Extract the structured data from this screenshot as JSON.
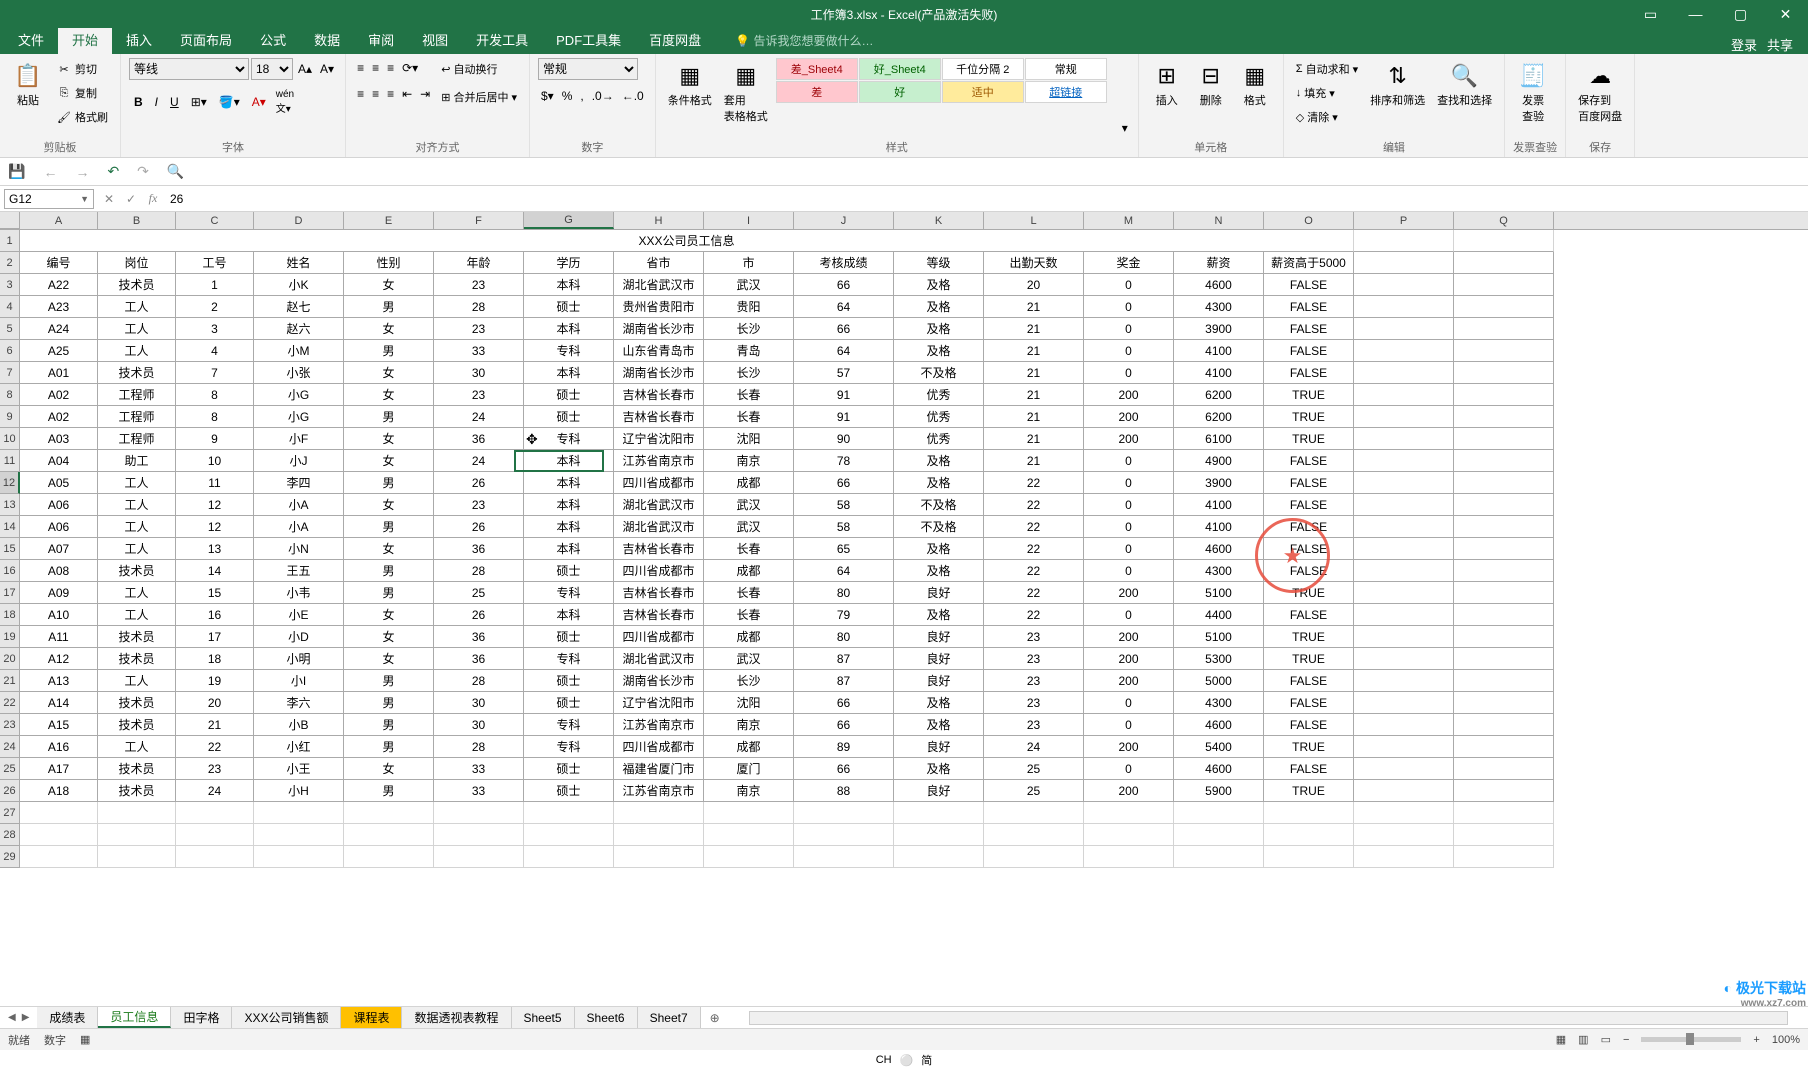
{
  "titlebar": {
    "title": "工作簿3.xlsx - Excel(产品激活失败)"
  },
  "ribbon_tabs": {
    "file": "文件",
    "home": "开始",
    "insert": "插入",
    "page_layout": "页面布局",
    "formulas": "公式",
    "data": "数据",
    "review": "审阅",
    "view": "视图",
    "dev": "开发工具",
    "pdf": "PDF工具集",
    "baidu": "百度网盘",
    "search_hint": "告诉我您想要做什么…",
    "login": "登录",
    "share": "共享"
  },
  "ribbon": {
    "clipboard": {
      "paste": "粘贴",
      "cut": "剪切",
      "copy": "复制",
      "format_painter": "格式刷",
      "group": "剪贴板"
    },
    "font": {
      "name": "等线",
      "size": "18",
      "group": "字体"
    },
    "align": {
      "wrap": "自动换行",
      "merge": "合并后居中",
      "group": "对齐方式"
    },
    "number": {
      "format": "常规",
      "group": "数字"
    },
    "styles": {
      "cond_format": "条件格式",
      "table_format": "套用\n表格格式",
      "s1": "差_Sheet4",
      "s2": "好_Sheet4",
      "s3": "千位分隔 2",
      "s4": "常规",
      "s5": "差",
      "s6": "好",
      "s7": "适中",
      "s8": "超链接",
      "group": "样式"
    },
    "cells": {
      "insert": "插入",
      "delete": "删除",
      "format": "格式",
      "group": "单元格"
    },
    "editing": {
      "autosum": "自动求和",
      "fill": "填充",
      "clear": "清除",
      "sort": "排序和筛选",
      "find": "查找和选择",
      "group": "编辑"
    },
    "invoice": {
      "check": "发票\n查验",
      "group": "发票查验"
    },
    "save": {
      "baidu": "保存到\n百度网盘",
      "group": "保存"
    }
  },
  "formula_bar": {
    "name_box": "G12",
    "formula": "26"
  },
  "columns": [
    "A",
    "B",
    "C",
    "D",
    "E",
    "F",
    "G",
    "H",
    "I",
    "J",
    "K",
    "L",
    "M",
    "N",
    "O",
    "P",
    "Q"
  ],
  "selected_col_idx": 6,
  "title_row": "XXX公司员工信息",
  "headers": [
    "编号",
    "岗位",
    "工号",
    "姓名",
    "性别",
    "年龄",
    "学历",
    "省市",
    "市",
    "考核成绩",
    "等级",
    "出勤天数",
    "奖金",
    "薪资",
    "薪资高于5000"
  ],
  "rows": [
    [
      "A22",
      "技术员",
      "1",
      "小K",
      "女",
      "23",
      "本科",
      "湖北省武汉市",
      "武汉",
      "66",
      "及格",
      "20",
      "0",
      "4600",
      "FALSE"
    ],
    [
      "A23",
      "工人",
      "2",
      "赵七",
      "男",
      "28",
      "硕士",
      "贵州省贵阳市",
      "贵阳",
      "64",
      "及格",
      "21",
      "0",
      "4300",
      "FALSE"
    ],
    [
      "A24",
      "工人",
      "3",
      "赵六",
      "女",
      "23",
      "本科",
      "湖南省长沙市",
      "长沙",
      "66",
      "及格",
      "21",
      "0",
      "3900",
      "FALSE"
    ],
    [
      "A25",
      "工人",
      "4",
      "小M",
      "男",
      "33",
      "专科",
      "山东省青岛市",
      "青岛",
      "64",
      "及格",
      "21",
      "0",
      "4100",
      "FALSE"
    ],
    [
      "A01",
      "技术员",
      "7",
      "小张",
      "女",
      "30",
      "本科",
      "湖南省长沙市",
      "长沙",
      "57",
      "不及格",
      "21",
      "0",
      "4100",
      "FALSE"
    ],
    [
      "A02",
      "工程师",
      "8",
      "小G",
      "女",
      "23",
      "硕士",
      "吉林省长春市",
      "长春",
      "91",
      "优秀",
      "21",
      "200",
      "6200",
      "TRUE"
    ],
    [
      "A02",
      "工程师",
      "8",
      "小G",
      "男",
      "24",
      "硕士",
      "吉林省长春市",
      "长春",
      "91",
      "优秀",
      "21",
      "200",
      "6200",
      "TRUE"
    ],
    [
      "A03",
      "工程师",
      "9",
      "小F",
      "女",
      "36",
      "专科",
      "辽宁省沈阳市",
      "沈阳",
      "90",
      "优秀",
      "21",
      "200",
      "6100",
      "TRUE"
    ],
    [
      "A04",
      "助工",
      "10",
      "小J",
      "女",
      "24",
      "本科",
      "江苏省南京市",
      "南京",
      "78",
      "及格",
      "21",
      "0",
      "4900",
      "FALSE"
    ],
    [
      "A05",
      "工人",
      "11",
      "李四",
      "男",
      "26",
      "本科",
      "四川省成都市",
      "成都",
      "66",
      "及格",
      "22",
      "0",
      "3900",
      "FALSE"
    ],
    [
      "A06",
      "工人",
      "12",
      "小A",
      "女",
      "23",
      "本科",
      "湖北省武汉市",
      "武汉",
      "58",
      "不及格",
      "22",
      "0",
      "4100",
      "FALSE"
    ],
    [
      "A06",
      "工人",
      "12",
      "小A",
      "男",
      "26",
      "本科",
      "湖北省武汉市",
      "武汉",
      "58",
      "不及格",
      "22",
      "0",
      "4100",
      "FALSE"
    ],
    [
      "A07",
      "工人",
      "13",
      "小N",
      "女",
      "36",
      "本科",
      "吉林省长春市",
      "长春",
      "65",
      "及格",
      "22",
      "0",
      "4600",
      "FALSE"
    ],
    [
      "A08",
      "技术员",
      "14",
      "王五",
      "男",
      "28",
      "硕士",
      "四川省成都市",
      "成都",
      "64",
      "及格",
      "22",
      "0",
      "4300",
      "FALSE"
    ],
    [
      "A09",
      "工人",
      "15",
      "小韦",
      "男",
      "25",
      "专科",
      "吉林省长春市",
      "长春",
      "80",
      "良好",
      "22",
      "200",
      "5100",
      "TRUE"
    ],
    [
      "A10",
      "工人",
      "16",
      "小E",
      "女",
      "26",
      "本科",
      "吉林省长春市",
      "长春",
      "79",
      "及格",
      "22",
      "0",
      "4400",
      "FALSE"
    ],
    [
      "A11",
      "技术员",
      "17",
      "小D",
      "女",
      "36",
      "硕士",
      "四川省成都市",
      "成都",
      "80",
      "良好",
      "23",
      "200",
      "5100",
      "TRUE"
    ],
    [
      "A12",
      "技术员",
      "18",
      "小明",
      "女",
      "36",
      "专科",
      "湖北省武汉市",
      "武汉",
      "87",
      "良好",
      "23",
      "200",
      "5300",
      "TRUE"
    ],
    [
      "A13",
      "工人",
      "19",
      "小I",
      "男",
      "28",
      "硕士",
      "湖南省长沙市",
      "长沙",
      "87",
      "良好",
      "23",
      "200",
      "5000",
      "FALSE"
    ],
    [
      "A14",
      "技术员",
      "20",
      "李六",
      "男",
      "30",
      "硕士",
      "辽宁省沈阳市",
      "沈阳",
      "66",
      "及格",
      "23",
      "0",
      "4300",
      "FALSE"
    ],
    [
      "A15",
      "技术员",
      "21",
      "小B",
      "男",
      "30",
      "专科",
      "江苏省南京市",
      "南京",
      "66",
      "及格",
      "23",
      "0",
      "4600",
      "FALSE"
    ],
    [
      "A16",
      "工人",
      "22",
      "小红",
      "男",
      "28",
      "专科",
      "四川省成都市",
      "成都",
      "89",
      "良好",
      "24",
      "200",
      "5400",
      "TRUE"
    ],
    [
      "A17",
      "技术员",
      "23",
      "小王",
      "女",
      "33",
      "硕士",
      "福建省厦门市",
      "厦门",
      "66",
      "及格",
      "25",
      "0",
      "4600",
      "FALSE"
    ],
    [
      "A18",
      "技术员",
      "24",
      "小H",
      "男",
      "33",
      "硕士",
      "江苏省南京市",
      "南京",
      "88",
      "良好",
      "25",
      "200",
      "5900",
      "TRUE"
    ]
  ],
  "selected_row_idx": 11,
  "sheet_tabs": {
    "t1": "成绩表",
    "t2": "员工信息",
    "t3": "田字格",
    "t4": "XXX公司销售额",
    "t5": "课程表",
    "t6": "数据透视表教程",
    "t7": "Sheet5",
    "t8": "Sheet6",
    "t9": "Sheet7"
  },
  "status": {
    "ready": "就绪",
    "mode": "数字",
    "zoom": "100%"
  },
  "ime": {
    "lang": "CH",
    "mode": "简"
  },
  "watermark": {
    "main": "极光下载站",
    "sub": "www.xz7.com"
  }
}
